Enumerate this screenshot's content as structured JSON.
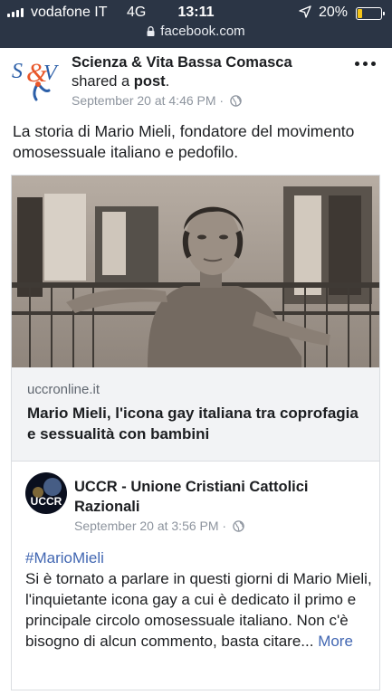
{
  "status_bar": {
    "carrier": "vodafone IT",
    "network": "4G",
    "time": "13:11",
    "battery": "20%",
    "battery_level": 0.2,
    "icons": [
      "signal-bars-icon",
      "location-arrow-icon",
      "battery-icon"
    ]
  },
  "url_bar": {
    "url": "facebook.com",
    "icon": "lock-icon"
  },
  "post": {
    "author": "Scienza & Vita Bassa Comasca",
    "action_prefix": "shared a ",
    "action_object": "post",
    "action_suffix": ".",
    "timestamp": "September 20 at 4:46 PM · ",
    "audience_icon": "globe-icon",
    "menu_icon": "more-dots-icon",
    "text": "La storia di Mario Mieli, fondatore del movimento omosessuale italiano e pedofilo."
  },
  "link_card": {
    "source": "uccronline.it",
    "title": "Mario Mieli, l'icona gay italiana tra coprofagia e sessualità con bambini"
  },
  "shared_post": {
    "author": "UCCR - Unione Cristiani Cattolici Razionali",
    "avatar_text": "UCCR",
    "timestamp": "September 20 at 3:56 PM · ",
    "audience_icon": "globe-icon",
    "hashtag": "#MarioMieli",
    "text": "Si è tornato a parlare in questi giorni di Mario Mieli, l'inquietante icona gay a cui è dedicato il primo e principale circolo omosessuale italiano. Non c'è bisogno di alcun commento, basta citare...",
    "more_label": "More"
  },
  "colors": {
    "status_bar_bg": "#2b3545",
    "link_blue": "#4267b2",
    "meta_gray": "#8d949e",
    "battery_yellow": "#f5c518",
    "logo_orange": "#e8572a",
    "logo_blue": "#2c5fa8"
  }
}
